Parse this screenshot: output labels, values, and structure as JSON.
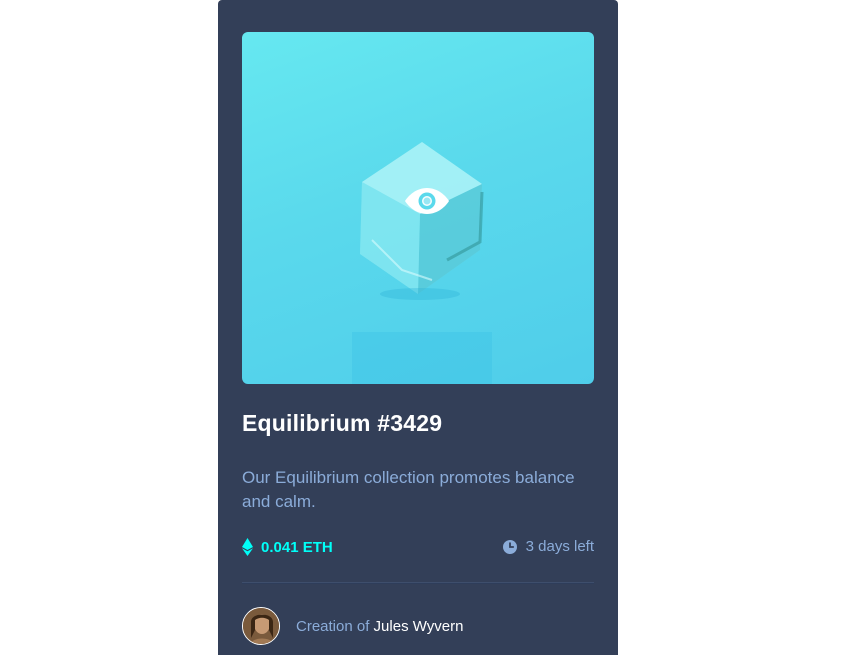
{
  "card": {
    "title": "Equilibrium #3429",
    "description": "Our Equilibrium collection promotes balance and calm.",
    "price": "0.041 ETH",
    "time_left": "3 days left",
    "creator_prefix": "Creation of",
    "creator_name": "Jules Wyvern"
  },
  "icons": {
    "view": "eye-icon",
    "price": "ethereum-icon",
    "time": "clock-icon"
  },
  "colors": {
    "page_background": "#ffffff",
    "card_background": "#333f58",
    "accent_cyan": "#00fff8",
    "muted_blue": "#8bacd9",
    "hero_cyan": "#5ad9ec"
  }
}
